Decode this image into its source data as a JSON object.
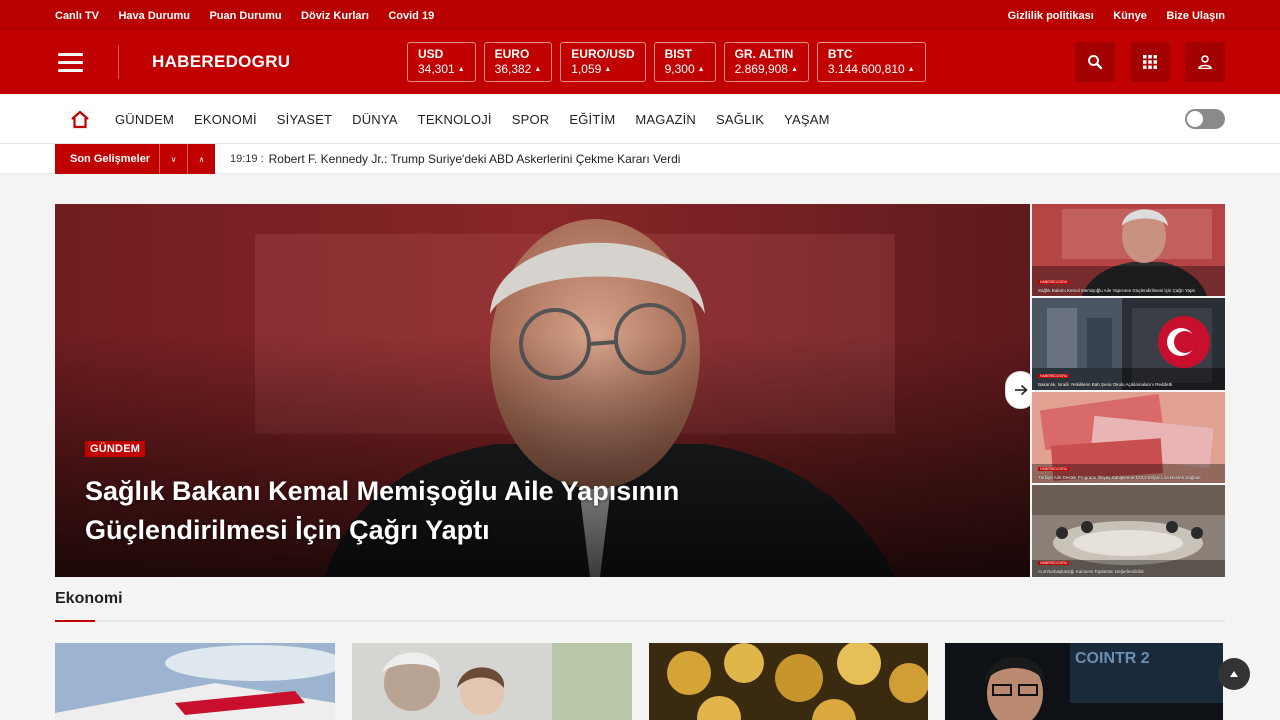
{
  "topbar": {
    "left_links": [
      "Canlı TV",
      "Hava Durumu",
      "Puan Durumu",
      "Döviz Kurları",
      "Covid 19"
    ],
    "right_links": [
      "Gizlilik politikası",
      "Künye",
      "Bize Ulaşın"
    ]
  },
  "header": {
    "logo": "HABEREDOGRU",
    "tickers": [
      {
        "name": "USD",
        "value": "34,301"
      },
      {
        "name": "EURO",
        "value": "36,382"
      },
      {
        "name": "EURO/USD",
        "value": "1,059"
      },
      {
        "name": "BIST",
        "value": "9,300"
      },
      {
        "name": "GR. ALTIN",
        "value": "2.869,908"
      },
      {
        "name": "BTC",
        "value": "3.144.600,810"
      }
    ],
    "icons": [
      "search-icon",
      "apps-grid-icon",
      "user-icon"
    ]
  },
  "nav": {
    "items": [
      "GÜNDEM",
      "EKONOMİ",
      "SİYASET",
      "DÜNYA",
      "TEKNOLOJİ",
      "SPOR",
      "EĞİTİM",
      "MAGAZİN",
      "SAĞLIK",
      "YAŞAM"
    ]
  },
  "breaking": {
    "label": "Son Gelişmeler",
    "time": "19:19 :",
    "text": "Robert F. Kennedy Jr.: Trump Suriye'deki ABD Askerlerini Çekme Kararı Verdi"
  },
  "hero": {
    "category": "GÜNDEM",
    "title": "Sağlık Bakanı Kemal Memişoğlu Aile Yapısının Güçlendirilmesi İçin Çağrı Yaptı",
    "side": [
      {
        "tag": "HABEREDOGRU",
        "caption": "Sağlık Bakanı Kemal Memişoğlu Aile Yapısının Güçlendirilmesi İçin Çağrı Yaptı"
      },
      {
        "tag": "HABEREDOGRU",
        "caption": "Bakanlık, İsrailli Yetkililerin Bab Şeria Okulu Açıklamalarını Reddetti"
      },
      {
        "tag": "HABEREDOGRU",
        "caption": "Türkiye Aile Destek Programı İhtiyaç Sahiplerine 103,2 Milyar Lira Destek Sağladı"
      },
      {
        "tag": "HABEREDOGRU",
        "caption": "Cumhurbaşkanlığı Kabinesi Toplantısı Değerlendirildi"
      }
    ]
  },
  "section": {
    "title": "Ekonomi"
  },
  "colors": {
    "brand": "#c10000",
    "brand_dark": "#a30000"
  }
}
